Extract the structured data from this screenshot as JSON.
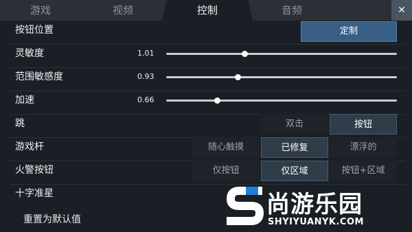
{
  "tabs": [
    "游戏",
    "视频",
    "控制",
    "音频"
  ],
  "active_tab": "控制",
  "rows": {
    "button_position": {
      "label": "按钮位置",
      "button": "定制"
    },
    "sensitivity": {
      "label": "灵敏度",
      "value": "1.01",
      "fraction": 0.34
    },
    "range_sensitivity": {
      "label": "范围敏感度",
      "value": "0.93",
      "fraction": 0.31
    },
    "accelerate": {
      "label": "加速",
      "value": "0.66",
      "fraction": 0.22
    },
    "jump": {
      "label": "跳",
      "options": [
        "双击",
        "按钮"
      ],
      "selected": "按钮"
    },
    "joystick": {
      "label": "游戏杆",
      "options": [
        "随心触摸",
        "已修复",
        "漂浮的"
      ],
      "selected": "已修复"
    },
    "fire_button": {
      "label": "火警按钮",
      "options": [
        "仅按钮",
        "仅区域",
        "按钮+区域"
      ],
      "selected": "仅区域"
    },
    "crosshair": {
      "label": "十字准星"
    }
  },
  "reset_label": "重置为默认值",
  "watermark": {
    "text": "尚游乐园",
    "url": "SHYIYUANYK.COM"
  },
  "colors": {
    "background": "#1a1f25",
    "tab_bar": "#2b3036",
    "primary_button": "#3a5f86",
    "selected_segment": "#2f3c49",
    "logo_accent": "#1e7fd6"
  }
}
